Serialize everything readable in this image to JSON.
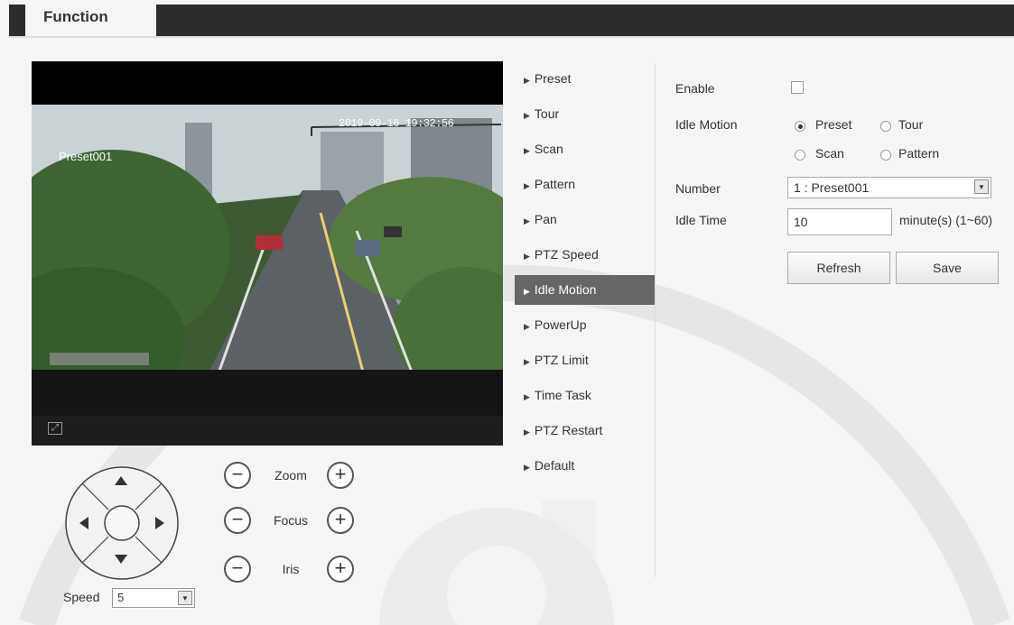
{
  "header": {
    "tab_label": "Function"
  },
  "video": {
    "osd_time": "2019-09-16 19:32:56",
    "osd_preset": "Preset001",
    "fullscreen_icon": "fullscreen-icon"
  },
  "ptz": {
    "zoom_label": "Zoom",
    "focus_label": "Focus",
    "iris_label": "Iris",
    "minus_glyph": "−",
    "plus_glyph": "+",
    "speed_label": "Speed",
    "speed_value": "5"
  },
  "menu": {
    "items": [
      {
        "label": "Preset"
      },
      {
        "label": "Tour"
      },
      {
        "label": "Scan"
      },
      {
        "label": "Pattern"
      },
      {
        "label": "Pan"
      },
      {
        "label": "PTZ Speed"
      },
      {
        "label": "Idle Motion",
        "active": true
      },
      {
        "label": "PowerUp"
      },
      {
        "label": "PTZ Limit"
      },
      {
        "label": "Time Task"
      },
      {
        "label": "PTZ Restart"
      },
      {
        "label": "Default"
      }
    ]
  },
  "form": {
    "enable_label": "Enable",
    "enable_checked": false,
    "idle_motion_label": "Idle Motion",
    "options": {
      "preset": "Preset",
      "tour": "Tour",
      "scan": "Scan",
      "pattern": "Pattern"
    },
    "selected_option": "Preset",
    "number_label": "Number",
    "number_value": "1 : Preset001",
    "idle_time_label": "Idle Time",
    "idle_time_value": "10",
    "idle_time_unit": "minute(s) (1~60)",
    "refresh_label": "Refresh",
    "save_label": "Save"
  },
  "colors": {
    "header_bg": "#2d2d2d",
    "active_menu_bg": "#666666",
    "page_bg": "#f5f5f5"
  }
}
